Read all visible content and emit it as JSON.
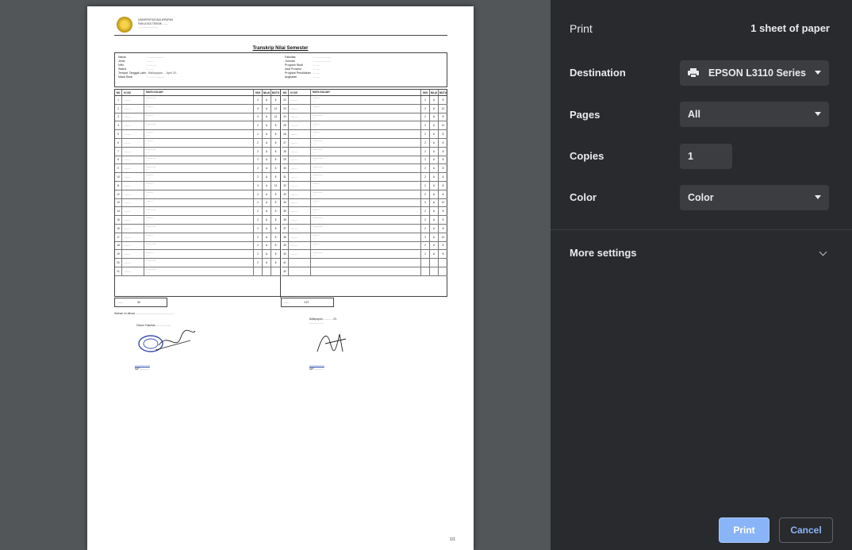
{
  "panel": {
    "title": "Print",
    "sheet_count": "1 sheet of paper",
    "destination": {
      "label": "Destination",
      "value": "EPSON L3110 Series",
      "icon": "printer-icon"
    },
    "pages": {
      "label": "Pages",
      "value": "All"
    },
    "copies": {
      "label": "Copies",
      "value": "1"
    },
    "color": {
      "label": "Color",
      "value": "Color"
    },
    "more_settings": {
      "label": "More settings",
      "icon": "chevron-down-icon"
    },
    "buttons": {
      "print": "Print",
      "cancel": "Cancel"
    },
    "colors": {
      "background": "#292a2d",
      "field": "#3c3d41",
      "accent": "#8ab4f8",
      "preview_background": "#525659"
    }
  },
  "document": {
    "header_lines": [
      "UNIVERSITAS BALIKPAPAN",
      "FAKULTAS TEKNIK ........",
      ".........................."
    ],
    "title": "Transkrip Nilai Semester",
    "info_left": [
      {
        "k": "Nama",
        "v": ": ...................."
      },
      {
        "k": "Jenis",
        "v": ": ......"
      },
      {
        "k": "NIM",
        "v": ": ..........."
      },
      {
        "k": "Status",
        "v": ": ......"
      },
      {
        "k": "Tempat, Tanggal Lahir",
        "v": ": Balikpapan, .. April 20.."
      },
      {
        "k": "Masa Studi",
        "v": ": ...................."
      }
    ],
    "info_right": [
      {
        "k": "Fakultas",
        "v": ": ...................."
      },
      {
        "k": "Jurusan",
        "v": ": ...................."
      },
      {
        "k": "Program Studi",
        "v": ": ......"
      },
      {
        "k": "Asal Provinsi",
        "v": ": ......"
      },
      {
        "k": "Program Pendidikan",
        "v": ": ......"
      },
      {
        "k": "Angkatan",
        "v": ": ......"
      }
    ],
    "table_header": {
      "no": "NO",
      "code": "KODE",
      "name": "MATA KULIAH",
      "sks": "SKS",
      "grade": "NILAI",
      "mutu": "MUTU"
    },
    "rows_left": [
      {
        "no": "1",
        "code": "..........",
        "name": "..............",
        "en": "......",
        "sks": "2",
        "grade": "A",
        "mutu": "8"
      },
      {
        "no": "2",
        "code": "..........",
        "name": "..........",
        "en": "......",
        "sks": "3",
        "grade": "A",
        "mutu": "12"
      },
      {
        "no": "3",
        "code": "..........",
        "name": "..........",
        "en": "......",
        "sks": "3",
        "grade": "A",
        "mutu": "12"
      },
      {
        "no": "4",
        "code": "..........",
        "name": "..............",
        "en": "......",
        "sks": "2",
        "grade": "A",
        "mutu": "8"
      },
      {
        "no": "5",
        "code": "..........",
        "name": "..........",
        "en": "......",
        "sks": "2",
        "grade": "A",
        "mutu": "8"
      },
      {
        "no": "6",
        "code": "..........",
        "name": "..........",
        "en": "......",
        "sks": "2",
        "grade": "A",
        "mutu": "8"
      },
      {
        "no": "7",
        "code": "..........",
        "name": "..............",
        "en": "......",
        "sks": "2",
        "grade": "A",
        "mutu": "8"
      },
      {
        "no": "8",
        "code": "..........",
        "name": "..............",
        "en": "......",
        "sks": "2",
        "grade": "A",
        "mutu": "8"
      },
      {
        "no": "9",
        "code": "..........",
        "name": "..............",
        "en": "......",
        "sks": "2",
        "grade": "A",
        "mutu": "8"
      },
      {
        "no": "10",
        "code": "..........",
        "name": "..........",
        "en": "......",
        "sks": "2",
        "grade": "A",
        "mutu": "8"
      },
      {
        "no": "11",
        "code": "..........",
        "name": "..........",
        "en": "......",
        "sks": "3",
        "grade": "A",
        "mutu": "12"
      },
      {
        "no": "12",
        "code": "..........",
        "name": "..........",
        "en": "......",
        "sks": "2",
        "grade": "A",
        "mutu": "8"
      },
      {
        "no": "13",
        "code": "..........",
        "name": "..........",
        "en": "......",
        "sks": "2",
        "grade": "A",
        "mutu": "8"
      },
      {
        "no": "14",
        "code": "..........",
        "name": "..............",
        "en": "......",
        "sks": "2",
        "grade": "A",
        "mutu": "8"
      },
      {
        "no": "15",
        "code": "..........",
        "name": "..........",
        "en": "......",
        "sks": "2",
        "grade": "A",
        "mutu": "8"
      },
      {
        "no": "16",
        "code": "..........",
        "name": "..............",
        "en": "......",
        "sks": "2",
        "grade": "A",
        "mutu": "8"
      },
      {
        "no": "17",
        "code": "..........",
        "name": "..........",
        "en": "......",
        "sks": "2",
        "grade": "A",
        "mutu": "8"
      },
      {
        "no": "18",
        "code": "..........",
        "name": "..............",
        "en": "......",
        "sks": "2",
        "grade": "A",
        "mutu": "8"
      },
      {
        "no": "19",
        "code": "..........",
        "name": "..........",
        "en": "......",
        "sks": "2",
        "grade": "A",
        "mutu": "8"
      },
      {
        "no": "20",
        "code": "..........",
        "name": "..............",
        "en": "......",
        "sks": "2",
        "grade": "A",
        "mutu": "8"
      },
      {
        "no": "21",
        "code": "..........",
        "name": "..............",
        "en": "......",
        "sks": "",
        "grade": "",
        "mutu": ""
      }
    ],
    "rows_right": [
      {
        "no": "22",
        "code": "..........",
        "name": "..........",
        "en": "......",
        "sks": "2",
        "grade": "A",
        "mutu": "8"
      },
      {
        "no": "23",
        "code": "..........",
        "name": "..........",
        "en": "......",
        "sks": "3",
        "grade": "A",
        "mutu": "12"
      },
      {
        "no": "24",
        "code": "..........",
        "name": "..............",
        "en": "......",
        "sks": "2",
        "grade": "A",
        "mutu": "8"
      },
      {
        "no": "25",
        "code": "..........",
        "name": "..........",
        "en": "......",
        "sks": "3",
        "grade": "A",
        "mutu": "12"
      },
      {
        "no": "26",
        "code": "..........",
        "name": "..........",
        "en": "......",
        "sks": "2",
        "grade": "A",
        "mutu": "8"
      },
      {
        "no": "27",
        "code": "..........",
        "name": "..............",
        "en": "......",
        "sks": "2",
        "grade": "A",
        "mutu": "8"
      },
      {
        "no": "28",
        "code": "..........",
        "name": "..............",
        "en": "......",
        "sks": "2",
        "grade": "A",
        "mutu": "8"
      },
      {
        "no": "29",
        "code": "..........",
        "name": "..............",
        "en": "......",
        "sks": "2",
        "grade": "A",
        "mutu": "8"
      },
      {
        "no": "30",
        "code": "..........",
        "name": "..............",
        "en": "......",
        "sks": "2",
        "grade": "A",
        "mutu": "8"
      },
      {
        "no": "31",
        "code": "..........",
        "name": "..............",
        "en": "......",
        "sks": "2",
        "grade": "A",
        "mutu": "8"
      },
      {
        "no": "32",
        "code": "..........",
        "name": "..........",
        "en": "......",
        "sks": "2",
        "grade": "A",
        "mutu": "8"
      },
      {
        "no": "33",
        "code": "..........",
        "name": "..............",
        "en": "......",
        "sks": "2",
        "grade": "A",
        "mutu": "8"
      },
      {
        "no": "34",
        "code": "..........",
        "name": "..........",
        "en": "......",
        "sks": "3",
        "grade": "A",
        "mutu": "12"
      },
      {
        "no": "35",
        "code": "..........",
        "name": "..........",
        "en": "......",
        "sks": "2",
        "grade": "A",
        "mutu": "8"
      },
      {
        "no": "36",
        "code": "..........",
        "name": "..............",
        "en": "......",
        "sks": "2",
        "grade": "A",
        "mutu": "8"
      },
      {
        "no": "37",
        "code": "..........",
        "name": "..............",
        "en": "......",
        "sks": "2",
        "grade": "A",
        "mutu": "8"
      },
      {
        "no": "38",
        "code": "..........",
        "name": "..........",
        "en": "......",
        "sks": "3",
        "grade": "A",
        "mutu": "12"
      },
      {
        "no": "39",
        "code": "..........",
        "name": "..........",
        "en": "......",
        "sks": "2",
        "grade": "A",
        "mutu": "8"
      },
      {
        "no": "40",
        "code": "..........",
        "name": "..............",
        "en": "......",
        "sks": "2",
        "grade": "A",
        "mutu": "8"
      },
      {
        "no": "41",
        "code": "",
        "name": "",
        "en": "",
        "sks": "",
        "grade": "",
        "mutu": ""
      },
      {
        "no": "42",
        "code": "",
        "name": "",
        "en": "",
        "sks": "",
        "grade": "",
        "mutu": ""
      }
    ],
    "summary_left": {
      "label": "........",
      "value": "96"
    },
    "summary_right": {
      "label": "........",
      "value": "3.67"
    },
    "note": "Salinan ini dibuat ....................................................",
    "sign_left": {
      "line1": "Dekan Fakultas ....................",
      "name": "....................",
      "id": "NIP ............"
    },
    "sign_right": {
      "line1": "Balikpapan, .. ........ 20..",
      "line2": "...................",
      "name": "....................",
      "id": "NIP ............"
    },
    "page_number": "1/1"
  }
}
